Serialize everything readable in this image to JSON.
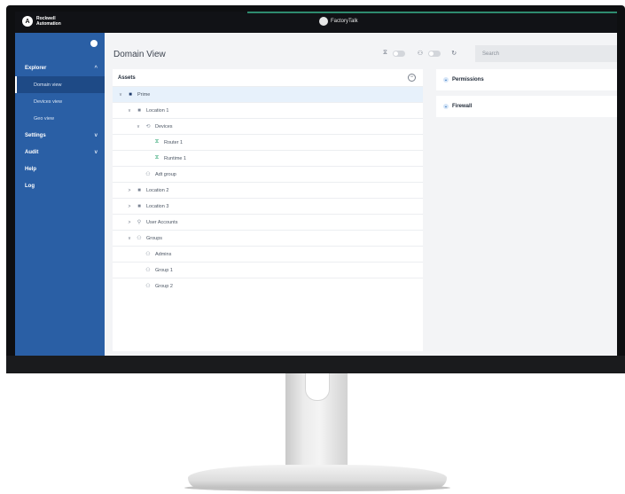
{
  "brand": {
    "left_name": "Rockwell\nAutomation",
    "center_name": "FactoryTalk"
  },
  "sidebar": {
    "items": [
      {
        "label": "Explorer",
        "chevron": "^",
        "type": "section"
      },
      {
        "label": "Domain view",
        "type": "sub",
        "active": true
      },
      {
        "label": "Devices view",
        "type": "sub"
      },
      {
        "label": "Geo view",
        "type": "sub"
      },
      {
        "label": "Settings",
        "chevron": "v",
        "type": "section"
      },
      {
        "label": "Audit",
        "chevron": "v",
        "type": "section"
      },
      {
        "label": "Help",
        "type": "section"
      },
      {
        "label": "Log",
        "type": "section"
      }
    ]
  },
  "main": {
    "title": "Domain View",
    "search_placeholder": "Search"
  },
  "assets": {
    "header": "Assets",
    "tree": [
      {
        "label": "Prime",
        "depth": 0,
        "toggle": "v",
        "icon": "folder-dark-icon",
        "selected": true
      },
      {
        "label": "Location 1",
        "depth": 1,
        "toggle": "v",
        "icon": "folder-icon"
      },
      {
        "label": "Devices",
        "depth": 2,
        "toggle": "v",
        "icon": "devices-icon"
      },
      {
        "label": "Router 1",
        "depth": 3,
        "toggle": "",
        "icon": "router-icon"
      },
      {
        "label": "Runtime 1",
        "depth": 3,
        "toggle": "",
        "icon": "router-icon"
      },
      {
        "label": "Adt group",
        "depth": 2,
        "toggle": "",
        "icon": "group-icon"
      },
      {
        "label": "Location 2",
        "depth": 1,
        "toggle": ">",
        "icon": "folder-icon"
      },
      {
        "label": "Location 3",
        "depth": 1,
        "toggle": ">",
        "icon": "folder-icon"
      },
      {
        "label": "User Accounts",
        "depth": 1,
        "toggle": ">",
        "icon": "user-icon"
      },
      {
        "label": "Groups",
        "depth": 1,
        "toggle": "v",
        "icon": "group-icon"
      },
      {
        "label": "Admins",
        "depth": 2,
        "toggle": "",
        "icon": "group-icon"
      },
      {
        "label": "Group 1",
        "depth": 2,
        "toggle": "",
        "icon": "group-icon"
      },
      {
        "label": "Group 2",
        "depth": 2,
        "toggle": "",
        "icon": "group-icon"
      }
    ]
  },
  "right": {
    "panels": [
      "Permissions",
      "Firewall"
    ]
  }
}
